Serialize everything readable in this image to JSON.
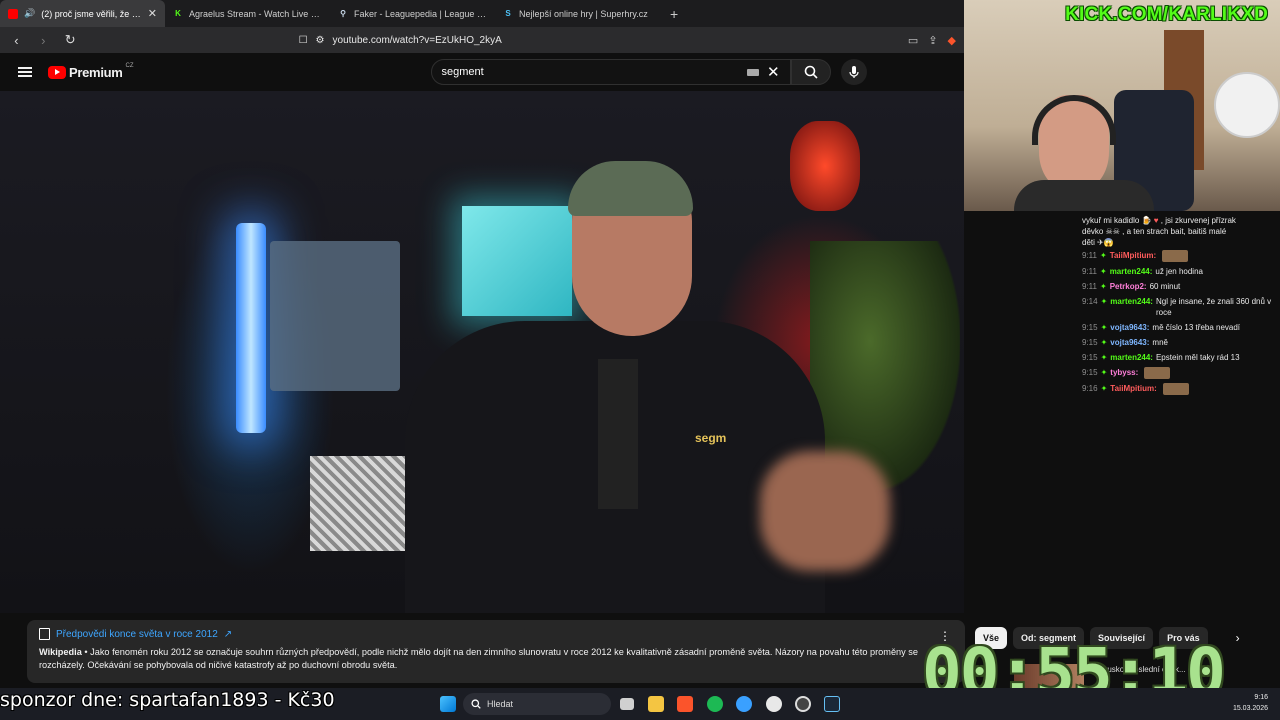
{
  "browser": {
    "tabs": [
      {
        "title": "(2) proč jsme věřili, že v roce",
        "active": true
      },
      {
        "title": "Agraelus Stream - Watch Live on Kick",
        "active": false
      },
      {
        "title": "Faker - Leaguepedia | League of Lege",
        "active": false
      },
      {
        "title": "Nejlepší online hry | Superhry.cz",
        "active": false
      }
    ],
    "new_tab": "+",
    "close": "✕",
    "url": "youtube.com/watch?v=EzUkHO_2kyA"
  },
  "youtube": {
    "logo_text": "Premium",
    "logo_region": "CZ",
    "search_value": "segment",
    "clear": "✕"
  },
  "video": {
    "mic_label": "segm"
  },
  "stream_overlay": {
    "kick_url": "KICK.COM/KARLIKXD",
    "sponsor": "sponzor dne: spartafan1893 - Kč30",
    "timer": "00:55:10"
  },
  "chat": {
    "top_lines": [
      "vykuř mi kadidlo",
      ", jsi zkurvenej přízrak",
      "děvko",
      ", a ten strach bait, baitiš malé",
      "děti"
    ],
    "messages": [
      {
        "time": "9:11",
        "user": "TaiiMpitium:",
        "color": "#ff5c5c",
        "text": ""
      },
      {
        "time": "9:11",
        "user": "marten244:",
        "color": "#53fc18",
        "text": "už jen hodina"
      },
      {
        "time": "9:11",
        "user": "Petrkop2:",
        "color": "#ff7fd9",
        "text": "60 minut"
      },
      {
        "time": "9:14",
        "user": "marten244:",
        "color": "#53fc18",
        "text": "Ngl je insane, že znali 360 dnů v roce"
      },
      {
        "time": "9:15",
        "user": "vojta9643:",
        "color": "#7fb7ff",
        "text": "mě číslo 13 třeba nevadí"
      },
      {
        "time": "9:15",
        "user": "vojta9643:",
        "color": "#7fb7ff",
        "text": "mně"
      },
      {
        "time": "9:15",
        "user": "marten244:",
        "color": "#53fc18",
        "text": "Epstein měl taky rád 13"
      },
      {
        "time": "9:15",
        "user": "tybyss:",
        "color": "#ff7fd9",
        "text": ""
      },
      {
        "time": "9:16",
        "user": "TaiiMpitium:",
        "color": "#ff5c5c",
        "text": ""
      }
    ]
  },
  "info_card": {
    "title": "Předpovědi konce světa v roce 2012",
    "source": "Wikipedia",
    "text": " • Jako fenomén roku 2012 se označuje souhrn různých předpovědí, podle nichž mělo dojít na den zimního slunovratu v roce 2012 ke kvalitativně zásadní proměně světa. Názory na povahu této proměny se rozcházely. Očekávání se pohybovala od ničivé katastrofy až po duchovní obrodu světa."
  },
  "chips": [
    "Vše",
    "Od: segment",
    "Související",
    "Pro vás"
  ],
  "related_partial": "Deprusko: Poslední opsk... diktatu...",
  "taskbar": {
    "search_placeholder": "Hledat",
    "time": "9:16",
    "date": "15.03.2026"
  },
  "colors": {
    "youtube_red": "#ff0000",
    "kick_green": "#53fc18",
    "link_blue": "#3ea6ff",
    "timer_green": "#a8e28e"
  }
}
